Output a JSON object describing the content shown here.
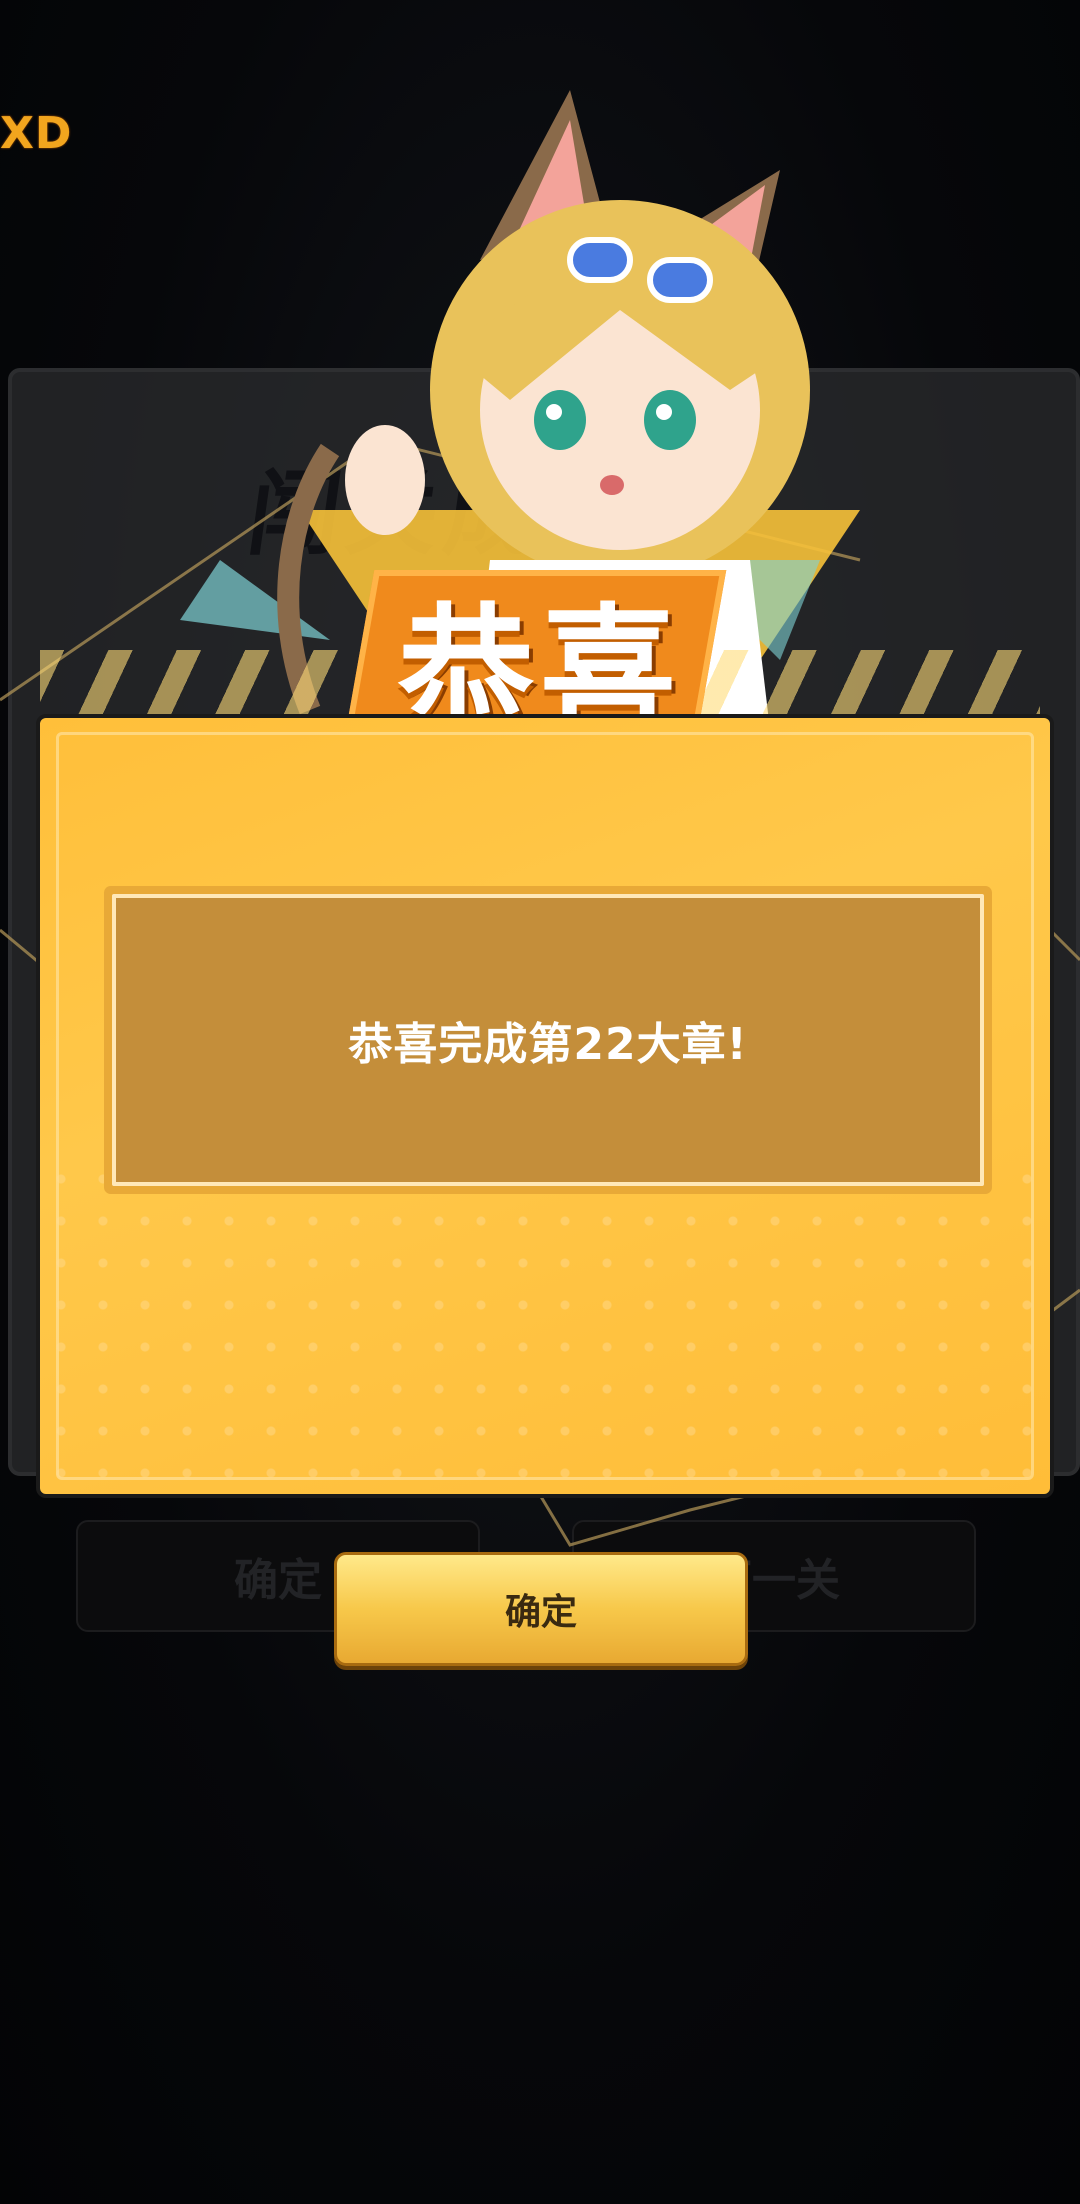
{
  "top_logo": "XD",
  "background": {
    "title": "闯关成功",
    "left_button": "确定",
    "right_button": "下一关"
  },
  "popup": {
    "title": "恭喜",
    "message": "恭喜完成第22大章!",
    "confirm_label": "确定"
  },
  "colors": {
    "accent": "#ffc84a",
    "badge": "#f08a1c",
    "message_box": "#c48e3a"
  }
}
